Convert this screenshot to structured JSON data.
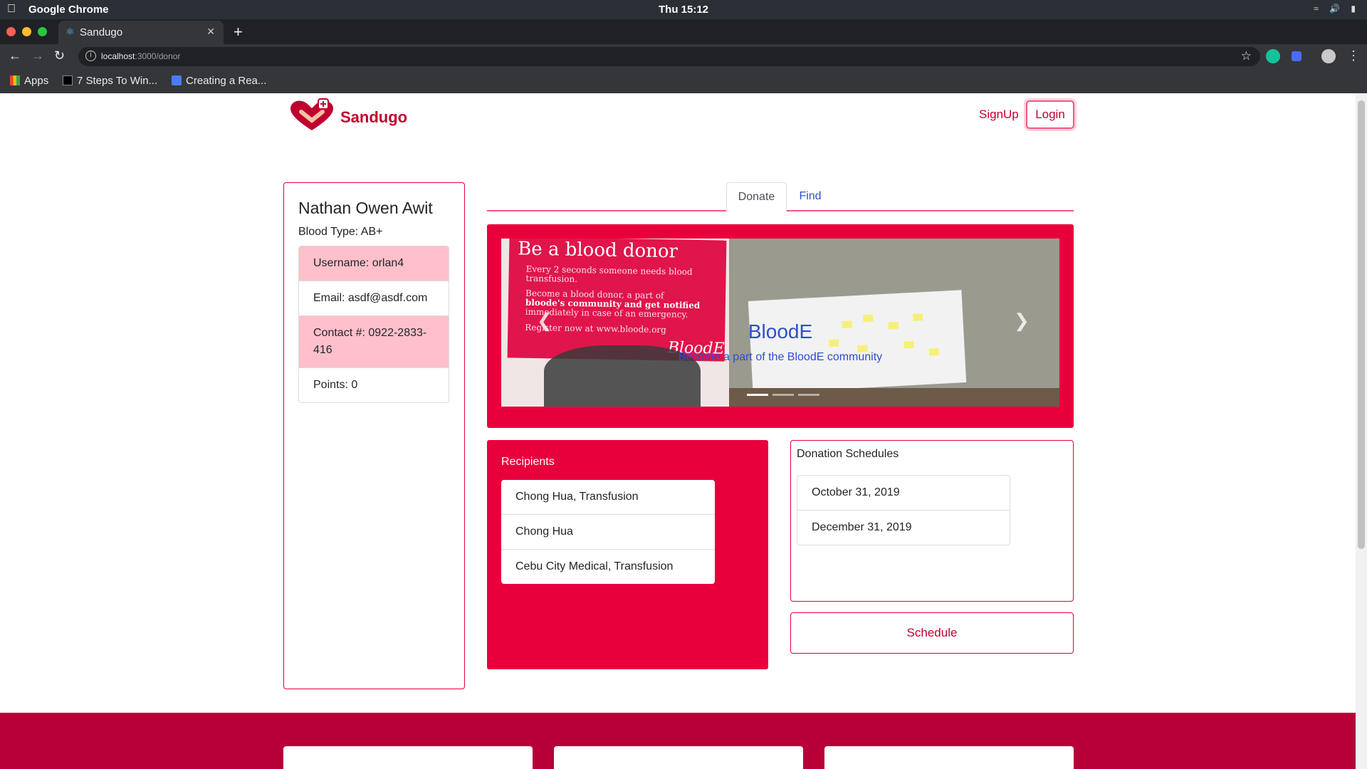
{
  "os": {
    "app_name": "Google Chrome",
    "clock": "Thu 15:12"
  },
  "browser": {
    "tab_title": "Sandugo",
    "url_host": "localhost",
    "url_path": ":3000/donor",
    "bookmarks": [
      "Apps",
      "7 Steps To Win...",
      "Creating a Rea..."
    ]
  },
  "nav": {
    "brand": "Sandugo",
    "signup": "SignUp",
    "login": "Login"
  },
  "profile": {
    "name": "Nathan Owen Awit",
    "blood_type": "Blood Type: AB+",
    "items": [
      "Username: orlan4",
      "Email: asdf@asdf.com",
      "Contact #: 0922-2833-416",
      "Points: 0"
    ]
  },
  "tabs": {
    "donate": "Donate",
    "find": "Find"
  },
  "carousel": {
    "caption_title": "BloodE",
    "caption_sub": "Become a part of the BloodE community",
    "banner_title": "Be a blood donor",
    "banner_line1": "Every 2 seconds someone needs blood",
    "banner_line2": "transfusion.",
    "banner_line3": "Become a blood donor, a part of",
    "banner_line4": "bloode's community and get notified",
    "banner_line5": "immediately in case of an emergency.",
    "banner_line6": "Register now at www.bloode.org",
    "banner_logo": "BloodE",
    "slide_count": 3,
    "active_slide": 1
  },
  "recipients": {
    "title": "Recipients",
    "items": [
      "Chong Hua, Transfusion",
      "Chong Hua",
      "Cebu City Medical, Transfusion"
    ]
  },
  "schedules": {
    "title": "Donation Schedules",
    "items": [
      "October 31, 2019",
      "December 31, 2019"
    ],
    "button": "Schedule"
  },
  "colors": {
    "primary": "#e8003d",
    "brand_text": "#c0002f",
    "link": "#2d4ecf",
    "pink_row": "#ffc0cb",
    "footer": "#b80038"
  }
}
